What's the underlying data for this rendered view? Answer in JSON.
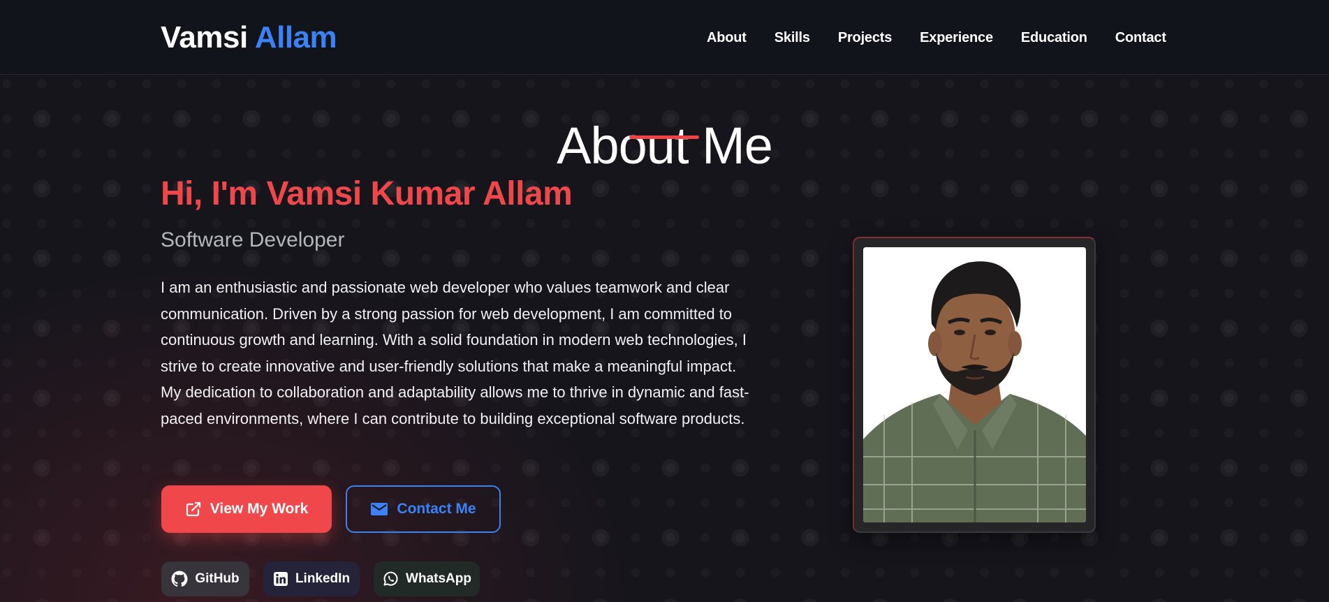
{
  "header": {
    "logo_first": "Vamsi",
    "logo_last": "Allam",
    "nav": [
      "About",
      "Skills",
      "Projects",
      "Experience",
      "Education",
      "Contact"
    ]
  },
  "about": {
    "title": "About Me",
    "greeting": "Hi, I'm Vamsi Kumar Allam",
    "role": "Software Developer",
    "bio": "I am an enthusiastic and passionate web developer who values teamwork and clear communication. Driven by a strong passion for web development, I am committed to continuous growth and learning. With a solid foundation in modern web technologies, I strive to create innovative and user-friendly solutions that make a meaningful impact. My dedication to collaboration and adaptability allows me to thrive in dynamic and fast-paced environments, where I can contribute to building exceptional software products.",
    "buttons": {
      "view_work": "View My Work",
      "view_work_icon": "external-link-icon",
      "contact": "Contact Me",
      "contact_icon": "mail-icon"
    },
    "social": [
      {
        "label": "GitHub",
        "icon": "github-icon"
      },
      {
        "label": "LinkedIn",
        "icon": "linkedin-icon"
      },
      {
        "label": "WhatsApp",
        "icon": "whatsapp-icon"
      }
    ],
    "photo": "profile-photo"
  },
  "colors": {
    "accent_red": "#f0474b",
    "accent_blue": "#3b82f6",
    "background": "#16151c",
    "header_bg": "#12141b"
  }
}
